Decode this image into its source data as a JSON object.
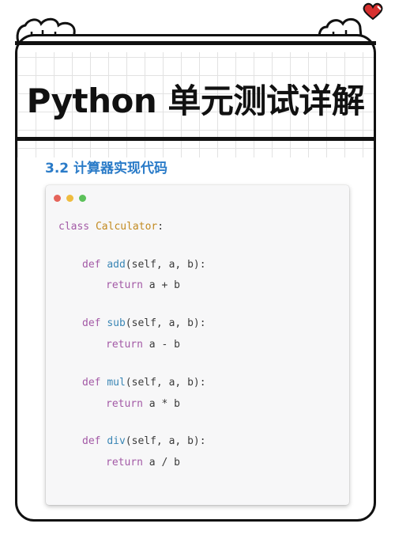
{
  "title": "Python 单元测试详解",
  "section": {
    "heading": "3.2 计算器实现代码"
  },
  "window": {
    "dot_colors": [
      "#e5645b",
      "#efbc3f",
      "#5cc15a"
    ]
  },
  "code": {
    "colors": {
      "keyword": "#a35aa6",
      "function": "#3a86b5",
      "class_name": "#c28a20",
      "text": "#3b3b3b"
    },
    "lines": [
      {
        "kw": "class",
        "name": "Calculator",
        "rest": ":"
      },
      {
        "kw": "def",
        "name": "add",
        "rest": "(self, a, b):"
      },
      {
        "kw": "return",
        "rest": " a + b"
      },
      {
        "kw": "def",
        "name": "sub",
        "rest": "(self, a, b):"
      },
      {
        "kw": "return",
        "rest": " a - b"
      },
      {
        "kw": "def",
        "name": "mul",
        "rest": "(self, a, b):"
      },
      {
        "kw": "return",
        "rest": " a * b"
      },
      {
        "kw": "def",
        "name": "div",
        "rest": "(self, a, b):"
      },
      {
        "kw": "return",
        "rest": " a / b"
      }
    ]
  },
  "decorations": {
    "heart_color": "#d6302f"
  }
}
